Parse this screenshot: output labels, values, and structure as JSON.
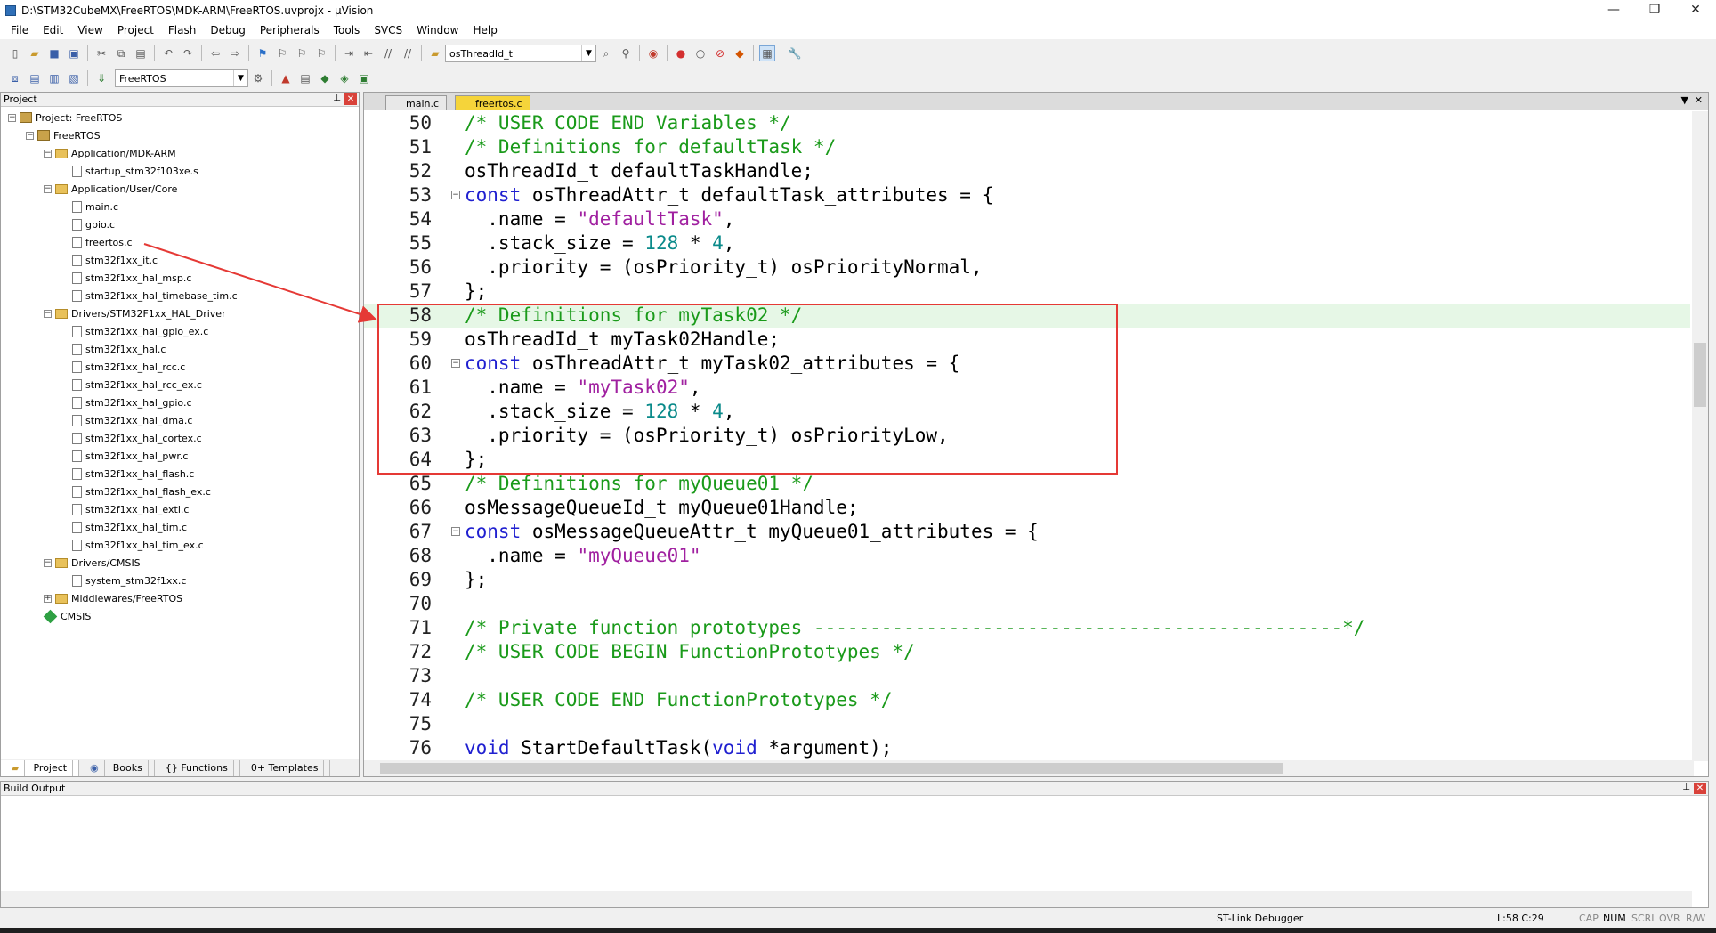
{
  "window": {
    "title": "D:\\STM32CubeMX\\FreeRTOS\\MDK-ARM\\FreeRTOS.uvprojx - µVision",
    "minimize": "—",
    "restore": "❐",
    "close": "✕"
  },
  "menu": [
    "File",
    "Edit",
    "View",
    "Project",
    "Flash",
    "Debug",
    "Peripherals",
    "Tools",
    "SVCS",
    "Window",
    "Help"
  ],
  "toolbar": {
    "find_combo": "osThreadId_t",
    "target_combo": "FreeRTOS"
  },
  "project_panel": {
    "title": "Project",
    "tree": [
      {
        "label": "Project: FreeRTOS",
        "kind": "project",
        "expander": "−"
      },
      {
        "label": "FreeRTOS",
        "kind": "target",
        "expander": "−"
      },
      {
        "label": "Application/MDK-ARM",
        "kind": "folder",
        "expander": "−"
      },
      {
        "label": "startup_stm32f103xe.s",
        "kind": "file"
      },
      {
        "label": "Application/User/Core",
        "kind": "folder",
        "expander": "−"
      },
      {
        "label": "main.c",
        "kind": "file"
      },
      {
        "label": "gpio.c",
        "kind": "file"
      },
      {
        "label": "freertos.c",
        "kind": "file"
      },
      {
        "label": "stm32f1xx_it.c",
        "kind": "file"
      },
      {
        "label": "stm32f1xx_hal_msp.c",
        "kind": "file"
      },
      {
        "label": "stm32f1xx_hal_timebase_tim.c",
        "kind": "file"
      },
      {
        "label": "Drivers/STM32F1xx_HAL_Driver",
        "kind": "folder",
        "expander": "−"
      },
      {
        "label": "stm32f1xx_hal_gpio_ex.c",
        "kind": "file"
      },
      {
        "label": "stm32f1xx_hal.c",
        "kind": "file"
      },
      {
        "label": "stm32f1xx_hal_rcc.c",
        "kind": "file"
      },
      {
        "label": "stm32f1xx_hal_rcc_ex.c",
        "kind": "file"
      },
      {
        "label": "stm32f1xx_hal_gpio.c",
        "kind": "file"
      },
      {
        "label": "stm32f1xx_hal_dma.c",
        "kind": "file"
      },
      {
        "label": "stm32f1xx_hal_cortex.c",
        "kind": "file"
      },
      {
        "label": "stm32f1xx_hal_pwr.c",
        "kind": "file"
      },
      {
        "label": "stm32f1xx_hal_flash.c",
        "kind": "file"
      },
      {
        "label": "stm32f1xx_hal_flash_ex.c",
        "kind": "file"
      },
      {
        "label": "stm32f1xx_hal_exti.c",
        "kind": "file"
      },
      {
        "label": "stm32f1xx_hal_tim.c",
        "kind": "file"
      },
      {
        "label": "stm32f1xx_hal_tim_ex.c",
        "kind": "file"
      },
      {
        "label": "Drivers/CMSIS",
        "kind": "folder",
        "expander": "−"
      },
      {
        "label": "system_stm32f1xx.c",
        "kind": "file"
      },
      {
        "label": "Middlewares/FreeRTOS",
        "kind": "folder",
        "expander": "+"
      },
      {
        "label": "CMSIS",
        "kind": "gem"
      }
    ],
    "tabs": [
      "Project",
      "Books",
      "{} Functions",
      "0+ Templates"
    ]
  },
  "editor": {
    "tabs": [
      "main.c",
      "freertos.c"
    ],
    "active_tab": "freertos.c",
    "lines": [
      {
        "n": "50",
        "segs": [
          [
            "c",
            "/* USER CODE END Variables */"
          ]
        ]
      },
      {
        "n": "51",
        "segs": [
          [
            "c",
            "/* Definitions for defaultTask */"
          ]
        ]
      },
      {
        "n": "52",
        "segs": [
          [
            "p",
            "osThreadId_t defaultTaskHandle;"
          ]
        ]
      },
      {
        "n": "53",
        "fold": "⊟",
        "segs": [
          [
            "k",
            "const"
          ],
          [
            "p",
            " osThreadAttr_t defaultTask_attributes = {"
          ]
        ]
      },
      {
        "n": "54",
        "segs": [
          [
            "p",
            "  .name = "
          ],
          [
            "s",
            "\"defaultTask\""
          ],
          [
            "p",
            ","
          ]
        ]
      },
      {
        "n": "55",
        "segs": [
          [
            "p",
            "  .stack_size = "
          ],
          [
            "n",
            "128"
          ],
          [
            "p",
            " * "
          ],
          [
            "n",
            "4"
          ],
          [
            "p",
            ","
          ]
        ]
      },
      {
        "n": "56",
        "segs": [
          [
            "p",
            "  .priority = (osPriority_t) osPriorityNormal,"
          ]
        ]
      },
      {
        "n": "57",
        "segs": [
          [
            "p",
            "};"
          ]
        ]
      },
      {
        "n": "58",
        "hl": true,
        "segs": [
          [
            "c",
            "/* Definitions for myTask02 */"
          ]
        ]
      },
      {
        "n": "59",
        "segs": [
          [
            "p",
            "osThreadId_t myTask02Handle;"
          ]
        ]
      },
      {
        "n": "60",
        "fold": "⊟",
        "segs": [
          [
            "k",
            "const"
          ],
          [
            "p",
            " osThreadAttr_t myTask02_attributes = {"
          ]
        ]
      },
      {
        "n": "61",
        "segs": [
          [
            "p",
            "  .name = "
          ],
          [
            "s",
            "\"myTask02\""
          ],
          [
            "p",
            ","
          ]
        ]
      },
      {
        "n": "62",
        "segs": [
          [
            "p",
            "  .stack_size = "
          ],
          [
            "n",
            "128"
          ],
          [
            "p",
            " * "
          ],
          [
            "n",
            "4"
          ],
          [
            "p",
            ","
          ]
        ]
      },
      {
        "n": "63",
        "segs": [
          [
            "p",
            "  .priority = (osPriority_t) osPriorityLow,"
          ]
        ]
      },
      {
        "n": "64",
        "segs": [
          [
            "p",
            "};"
          ]
        ]
      },
      {
        "n": "65",
        "segs": [
          [
            "c",
            "/* Definitions for myQueue01 */"
          ]
        ]
      },
      {
        "n": "66",
        "segs": [
          [
            "p",
            "osMessageQueueId_t myQueue01Handle;"
          ]
        ]
      },
      {
        "n": "67",
        "fold": "⊟",
        "segs": [
          [
            "k",
            "const"
          ],
          [
            "p",
            " osMessageQueueAttr_t myQueue01_attributes = {"
          ]
        ]
      },
      {
        "n": "68",
        "segs": [
          [
            "p",
            "  .name = "
          ],
          [
            "s",
            "\"myQueue01\""
          ]
        ]
      },
      {
        "n": "69",
        "segs": [
          [
            "p",
            "};"
          ]
        ]
      },
      {
        "n": "70",
        "segs": []
      },
      {
        "n": "71",
        "segs": [
          [
            "c",
            "/* Private function prototypes -----------------------------------------------*/"
          ]
        ]
      },
      {
        "n": "72",
        "segs": [
          [
            "c",
            "/* USER CODE BEGIN FunctionPrototypes */"
          ]
        ]
      },
      {
        "n": "73",
        "segs": []
      },
      {
        "n": "74",
        "segs": [
          [
            "c",
            "/* USER CODE END FunctionPrototypes */"
          ]
        ]
      },
      {
        "n": "75",
        "segs": []
      },
      {
        "n": "76",
        "segs": [
          [
            "k",
            "void"
          ],
          [
            "p",
            " StartDefaultTask("
          ],
          [
            "k",
            "void"
          ],
          [
            "p",
            " *argument);"
          ]
        ]
      }
    ]
  },
  "build_output": {
    "title": "Build Output"
  },
  "status": {
    "debugger": "ST-Link Debugger",
    "position": "L:58 C:29",
    "cap": "CAP",
    "num": "NUM",
    "scrl": "SCRL",
    "ovr": "OVR",
    "rw": "R/W"
  },
  "colors": {
    "highlight": "#e6f7e6",
    "annotation": "#e53935",
    "comment": "#1a9a1a",
    "keyword": "#2020d0",
    "string": "#a020a0",
    "number": "#0a8a8a"
  }
}
